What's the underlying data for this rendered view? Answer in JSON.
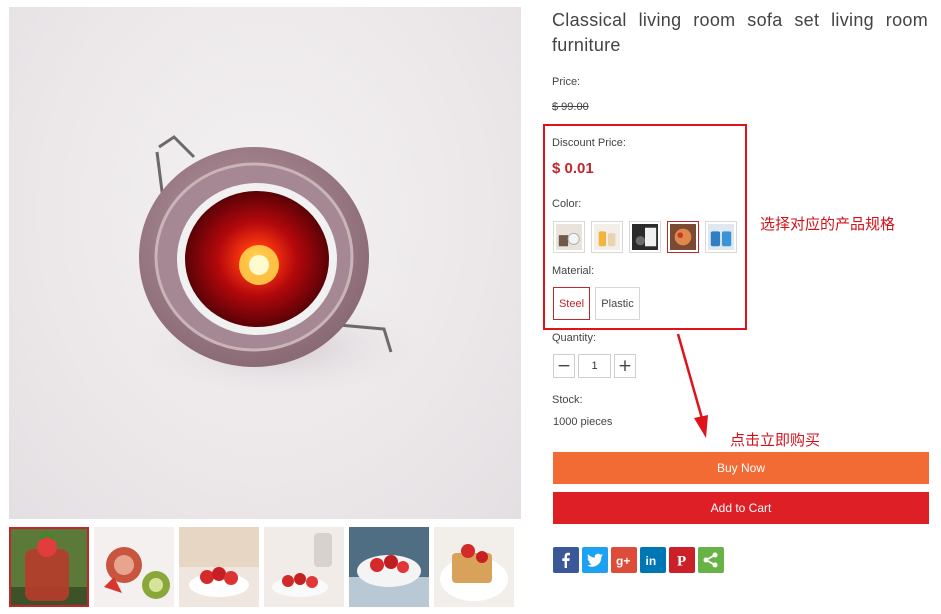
{
  "product": {
    "title": "Classical living room sofa set living room furniture",
    "price_label": "Price:",
    "original_price": "$ 99.00",
    "discount_label": "Discount Price:",
    "discount_price": "$ 0.01",
    "color_label": "Color:",
    "colors": [
      {
        "icon": "kitchen-items-swatch",
        "selected": false
      },
      {
        "icon": "jars-swatch",
        "selected": false
      },
      {
        "icon": "dark-items-swatch",
        "selected": false
      },
      {
        "icon": "food-plate-swatch",
        "selected": true
      },
      {
        "icon": "blue-containers-swatch",
        "selected": false
      }
    ],
    "material_label": "Material:",
    "materials": [
      {
        "label": "Steel",
        "selected": true
      },
      {
        "label": "Plastic",
        "selected": false
      }
    ],
    "quantity_label": "Quantity:",
    "quantity": "1",
    "stock_label": "Stock:",
    "stock_value": "1000 pieces"
  },
  "actions": {
    "buy_now": "Buy Now",
    "add_to_cart": "Add to Cart"
  },
  "annotations": {
    "select_spec": "选择对应的产品规格",
    "click_buy": "点击立即购买"
  },
  "thumbnails": [
    {
      "icon": "strawberry-jar-thumb",
      "active": true
    },
    {
      "icon": "strawberry-kiwi-thumb",
      "active": false
    },
    {
      "icon": "strawberry-bowl-thumb",
      "active": false
    },
    {
      "icon": "strawberry-dish-thumb",
      "active": false
    },
    {
      "icon": "strawberry-boat-thumb",
      "active": false
    },
    {
      "icon": "waffle-thumb",
      "active": false
    }
  ],
  "share": [
    {
      "icon": "facebook-icon",
      "glyph": "f",
      "color": "#3b5998"
    },
    {
      "icon": "twitter-icon",
      "glyph": "t",
      "color": "#1da1f2"
    },
    {
      "icon": "google-plus-icon",
      "glyph": "g+",
      "color": "#dd4b39"
    },
    {
      "icon": "linkedin-icon",
      "glyph": "in",
      "color": "#0077b5"
    },
    {
      "icon": "pinterest-icon",
      "glyph": "P",
      "color": "#cb2027"
    },
    {
      "icon": "share-icon",
      "glyph": "<",
      "color": "#67b346"
    }
  ],
  "colors": {
    "accent_red": "#c0272d",
    "buy_now_bg": "#f26b35",
    "add_to_cart_bg": "#df1f26",
    "annotation_red": "#d0121b"
  }
}
